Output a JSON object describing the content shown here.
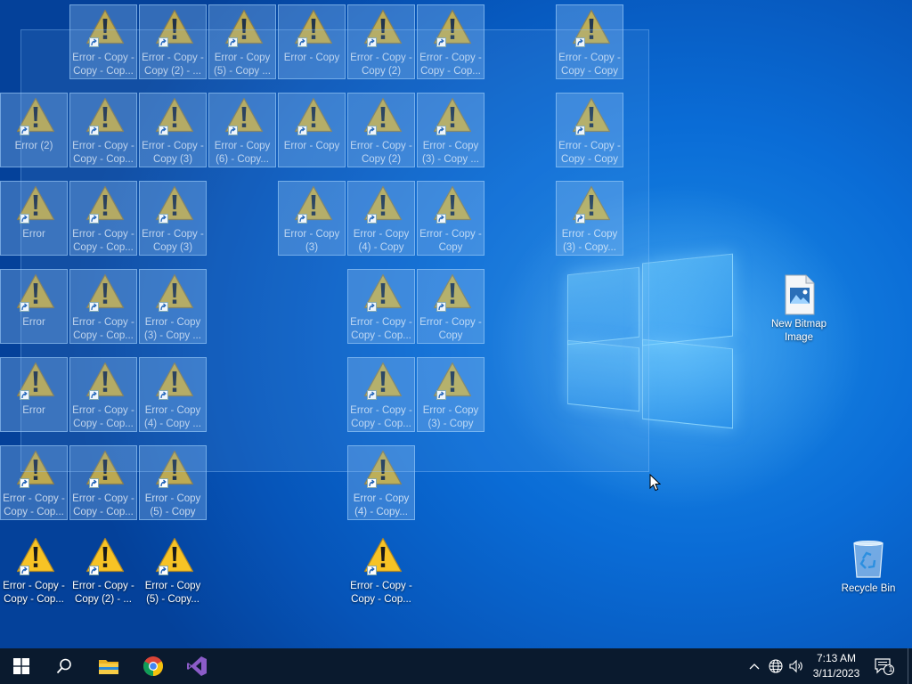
{
  "desktop": {
    "error_icons": [
      {
        "label": "Error - Copy - Copy - Cop...",
        "col": 1,
        "row": 0,
        "selected": true
      },
      {
        "label": "Error - Copy - Copy (2) - ...",
        "col": 2,
        "row": 0,
        "selected": true
      },
      {
        "label": "Error - Copy (5) - Copy ...",
        "col": 3,
        "row": 0,
        "selected": true
      },
      {
        "label": "Error - Copy",
        "col": 4,
        "row": 0,
        "selected": true
      },
      {
        "label": "Error - Copy - Copy (2)",
        "col": 5,
        "row": 0,
        "selected": true
      },
      {
        "label": "Error - Copy - Copy - Cop...",
        "col": 6,
        "row": 0,
        "selected": true
      },
      {
        "label": "Error - Copy - Copy - Copy",
        "col": 8,
        "row": 0,
        "selected": true
      },
      {
        "label": "Error (2)",
        "col": 0,
        "row": 1,
        "selected": true
      },
      {
        "label": "Error - Copy - Copy - Cop...",
        "col": 1,
        "row": 1,
        "selected": true
      },
      {
        "label": "Error - Copy - Copy (3)",
        "col": 2,
        "row": 1,
        "selected": true
      },
      {
        "label": "Error - Copy (6) - Copy...",
        "col": 3,
        "row": 1,
        "selected": true
      },
      {
        "label": "Error - Copy",
        "col": 4,
        "row": 1,
        "selected": true
      },
      {
        "label": "Error - Copy - Copy (2)",
        "col": 5,
        "row": 1,
        "selected": true
      },
      {
        "label": "Error - Copy (3) - Copy ...",
        "col": 6,
        "row": 1,
        "selected": true
      },
      {
        "label": "Error - Copy - Copy - Copy",
        "col": 8,
        "row": 1,
        "selected": true
      },
      {
        "label": "Error",
        "col": 0,
        "row": 2,
        "selected": true
      },
      {
        "label": "Error - Copy - Copy - Cop...",
        "col": 1,
        "row": 2,
        "selected": true
      },
      {
        "label": "Error - Copy - Copy (3)",
        "col": 2,
        "row": 2,
        "selected": true
      },
      {
        "label": "Error - Copy (3)",
        "col": 4,
        "row": 2,
        "selected": true
      },
      {
        "label": "Error - Copy (4) - Copy",
        "col": 5,
        "row": 2,
        "selected": true
      },
      {
        "label": "Error - Copy - Copy",
        "col": 6,
        "row": 2,
        "selected": true
      },
      {
        "label": "Error - Copy (3) - Copy...",
        "col": 8,
        "row": 2,
        "selected": true
      },
      {
        "label": "Error",
        "col": 0,
        "row": 3,
        "selected": true
      },
      {
        "label": "Error - Copy - Copy - Cop...",
        "col": 1,
        "row": 3,
        "selected": true
      },
      {
        "label": "Error - Copy (3) - Copy ...",
        "col": 2,
        "row": 3,
        "selected": true
      },
      {
        "label": "Error - Copy - Copy - Cop...",
        "col": 5,
        "row": 3,
        "selected": true
      },
      {
        "label": "Error - Copy - Copy",
        "col": 6,
        "row": 3,
        "selected": true
      },
      {
        "label": "Error",
        "col": 0,
        "row": 4,
        "selected": true
      },
      {
        "label": "Error - Copy - Copy - Cop...",
        "col": 1,
        "row": 4,
        "selected": true
      },
      {
        "label": "Error - Copy (4) - Copy ...",
        "col": 2,
        "row": 4,
        "selected": true
      },
      {
        "label": "Error - Copy - Copy - Cop...",
        "col": 5,
        "row": 4,
        "selected": true
      },
      {
        "label": "Error - Copy (3) - Copy",
        "col": 6,
        "row": 4,
        "selected": true
      },
      {
        "label": "Error - Copy - Copy - Cop...",
        "col": 0,
        "row": 5,
        "selected": true
      },
      {
        "label": "Error - Copy - Copy - Cop...",
        "col": 1,
        "row": 5,
        "selected": true
      },
      {
        "label": "Error - Copy (5) - Copy",
        "col": 2,
        "row": 5,
        "selected": true
      },
      {
        "label": "Error - Copy (4) - Copy...",
        "col": 5,
        "row": 5,
        "selected": true
      },
      {
        "label": "Error - Copy - Copy - Cop...",
        "col": 0,
        "row": 6,
        "selected": false
      },
      {
        "label": "Error - Copy - Copy (2) - ...",
        "col": 1,
        "row": 6,
        "selected": false
      },
      {
        "label": "Error - Copy (5) - Copy...",
        "col": 2,
        "row": 6,
        "selected": false
      },
      {
        "label": "Error - Copy - Copy - Cop...",
        "col": 5,
        "row": 6,
        "selected": false
      }
    ],
    "bitmap_icon": {
      "label": "New Bitmap Image"
    },
    "recycle_bin": {
      "label": "Recycle Bin"
    }
  },
  "taskbar": {
    "start_icon": "windows-start-icon",
    "search_icon": "search-icon",
    "pinned": [
      "file-explorer-icon",
      "chrome-icon",
      "visual-studio-icon"
    ],
    "tray": {
      "show_hidden_icon": "chevron-up-icon",
      "network_icon": "globe-icon",
      "volume_icon": "speaker-icon",
      "time": "7:13 AM",
      "date": "3/11/2023",
      "notifications_icon": "action-center-icon",
      "notification_count": "1"
    }
  },
  "colors": {
    "taskbar_bg": "#0a1a2e",
    "warning_yellow": "#f7c325",
    "desktop_blue": "#0a6cd6"
  }
}
